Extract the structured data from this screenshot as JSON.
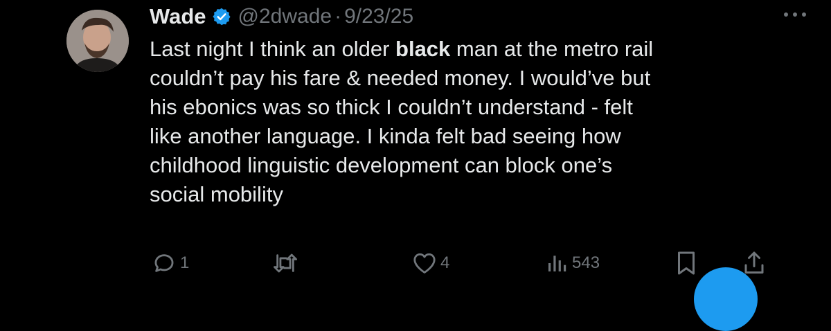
{
  "author": {
    "name": "Wade",
    "handle": "@2dwade",
    "separator": "·",
    "date": "9/23/25",
    "verified": true,
    "verified_color": "#1d9bf0"
  },
  "tweet": {
    "text_before_bold": "Last night I think an older ",
    "text_bold": "black",
    "text_after_bold": " man at the metro rail\ncouldn’t pay his fare & needed money. I would’ve but\nhis ebonics was so thick I couldn’t understand - felt\nlike another language. I kinda felt bad seeing how\nchildhood linguistic development can block one’s\nsocial mobility"
  },
  "actions": {
    "reply_icon": "reply-icon",
    "reply_count": "1",
    "retweet_icon": "retweet-icon",
    "like_icon": "heart-icon",
    "like_count": "4",
    "views_icon": "views-icon",
    "views_count": "543",
    "bookmark_icon": "bookmark-icon",
    "share_icon": "share-icon"
  },
  "colors": {
    "background": "#000000",
    "text": "#e7e9ea",
    "muted": "#71767b",
    "accent": "#1d9bf0"
  }
}
